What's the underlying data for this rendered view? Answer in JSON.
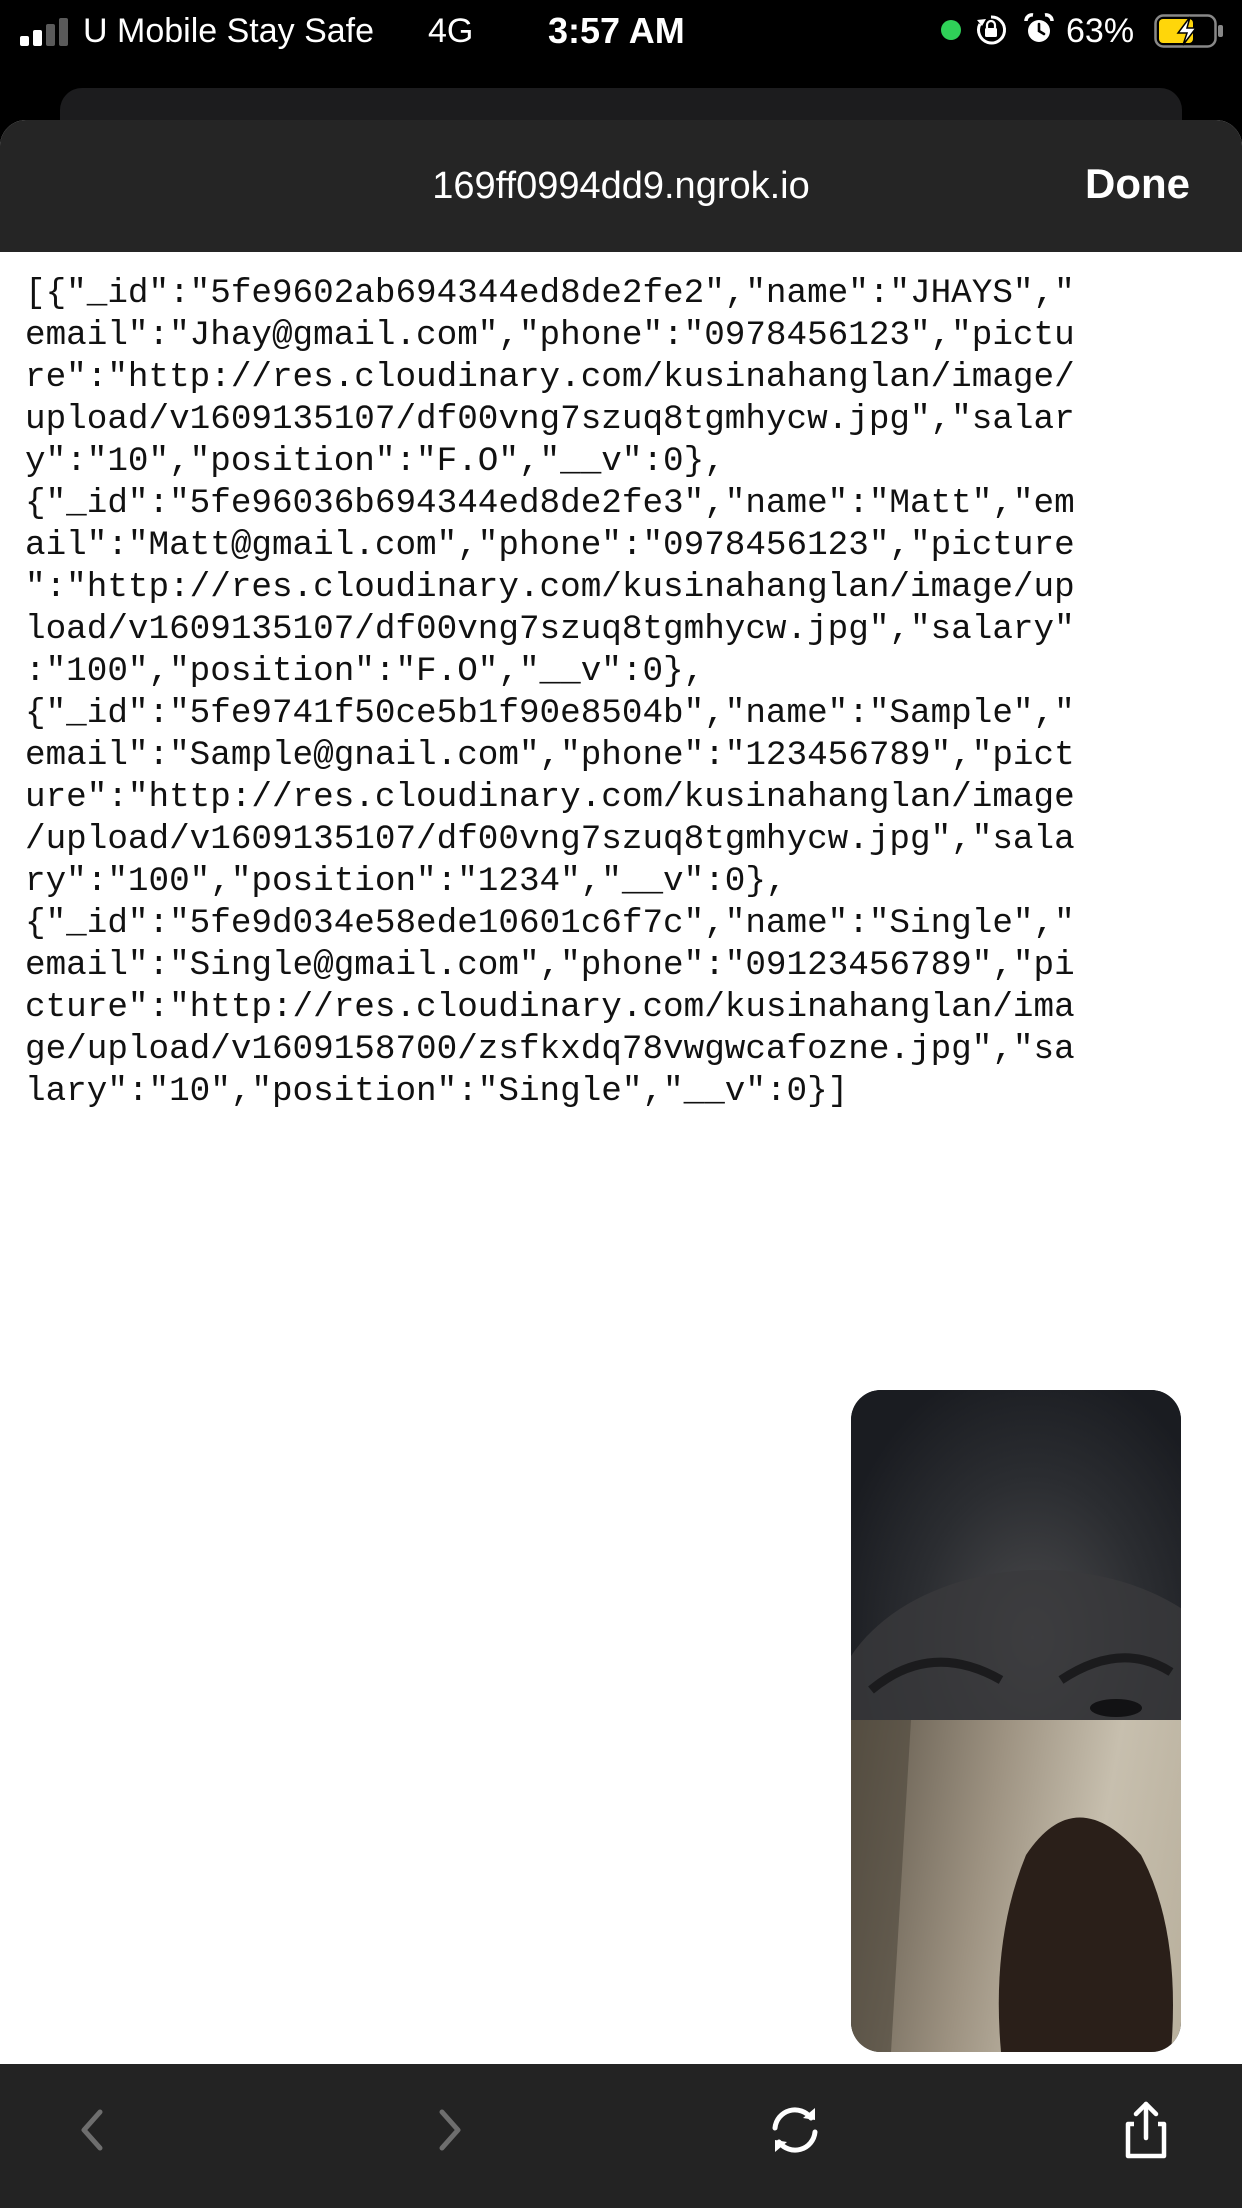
{
  "status_bar": {
    "carrier": "U Mobile Stay Safe",
    "network": "4G",
    "time": "3:57 AM",
    "battery_percent": "63%",
    "battery_level": 0.63,
    "icons": [
      "signal-icon",
      "camera-in-use-dot",
      "rotation-lock-icon",
      "alarm-icon",
      "battery-charging-icon"
    ]
  },
  "nav": {
    "url": "169ff0994dd9.ngrok.io",
    "done_label": "Done"
  },
  "content": {
    "json_text": "[{\"_id\":\"5fe9602ab694344ed8de2fe2\",\"name\":\"JHAYS\",\"email\":\"Jhay@gmail.com\",\"phone\":\"0978456123\",\"picture\":\"http://res.cloudinary.com/kusinahanglan/image/upload/v1609135107/df00vng7szuq8tgmhycw.jpg\",\"salary\":\"10\",\"position\":\"F.O\",\"__v\":0},{\"_id\":\"5fe96036b694344ed8de2fe3\",\"name\":\"Matt\",\"email\":\"Matt@gmail.com\",\"phone\":\"0978456123\",\"picture\":\"http://res.cloudinary.com/kusinahanglan/image/upload/v1609135107/df00vng7szuq8tgmhycw.jpg\",\"salary\":\"100\",\"position\":\"F.O\",\"__v\":0},{\"_id\":\"5fe9741f50ce5b1f90e8504b\",\"name\":\"Sample\",\"email\":\"Sample@gnail.com\",\"phone\":\"123456789\",\"picture\":\"http://res.cloudinary.com/kusinahanglan/image/upload/v1609135107/df00vng7szuq8tgmhycw.jpg\",\"salary\":\"100\",\"position\":\"1234\",\"__v\":0},{\"_id\":\"5fe9d034e58ede10601c6f7c\",\"name\":\"Single\",\"email\":\"Single@gmail.com\",\"phone\":\"09123456789\",\"picture\":\"http://res.cloudinary.com/kusinahanglan/image/upload/v1609158700/zsfkxdq78vwgwcafozne.jpg\",\"salary\":\"10\",\"position\":\"Single\",\"__v\":0}]"
  },
  "video_call": {
    "tiles": [
      "remote-video-tile",
      "self-video-tile"
    ]
  },
  "toolbar": {
    "items": [
      "back-icon",
      "forward-icon",
      "reload-icon",
      "share-icon"
    ]
  },
  "colors": {
    "toolbar_bg": "#232323",
    "nav_bg": "#252525",
    "status_dot": "#2fd158",
    "battery_fill": "#ffd60a"
  }
}
